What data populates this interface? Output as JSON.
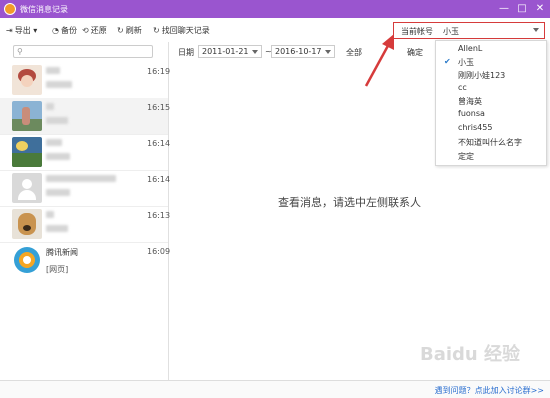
{
  "window": {
    "title": "微信消息记录",
    "minimize_icon": "—",
    "maximize_icon": "□",
    "close_icon": "✕"
  },
  "toolbar": {
    "export_label": "导出",
    "backup_label": "备份",
    "restore_label": "还原",
    "refresh_label": "刷新",
    "recover_label": "找回聊天记录"
  },
  "account": {
    "label": "当前帐号",
    "value": "小玉"
  },
  "search": {
    "placeholder": ""
  },
  "contacts": [
    {
      "name_blurred": true,
      "time": "16:19"
    },
    {
      "name_blurred": true,
      "time": "16:15"
    },
    {
      "name_blurred": true,
      "time": "16:14"
    },
    {
      "name_blurred": true,
      "time": "16:14"
    },
    {
      "name_blurred": true,
      "time": "16:13"
    },
    {
      "name": "腾讯新闻",
      "time": "16:09",
      "preview": "[网页]"
    }
  ],
  "filter": {
    "date_label": "日期",
    "start_date": "2011-01-21",
    "separator": "~",
    "end_date": "2016-10-17",
    "type_value": "全部",
    "confirm_label": "确定"
  },
  "main": {
    "placeholder": "查看消息，请选中左侧联系人"
  },
  "account_dropdown": {
    "items": [
      "AllenL",
      "小玉",
      "刚刚小娃123",
      "cc",
      "曾海英",
      "fuonsa",
      "chris455",
      "不知道叫什么名字",
      "定定"
    ],
    "selected_index": 1
  },
  "status": {
    "link": "遇到问题？点此加入讨论群>>"
  },
  "watermark": "Baidu 经验",
  "colors": {
    "titlebar": "#9a55cf",
    "highlight_border": "#d63b3b",
    "link": "#2b6fd0"
  }
}
